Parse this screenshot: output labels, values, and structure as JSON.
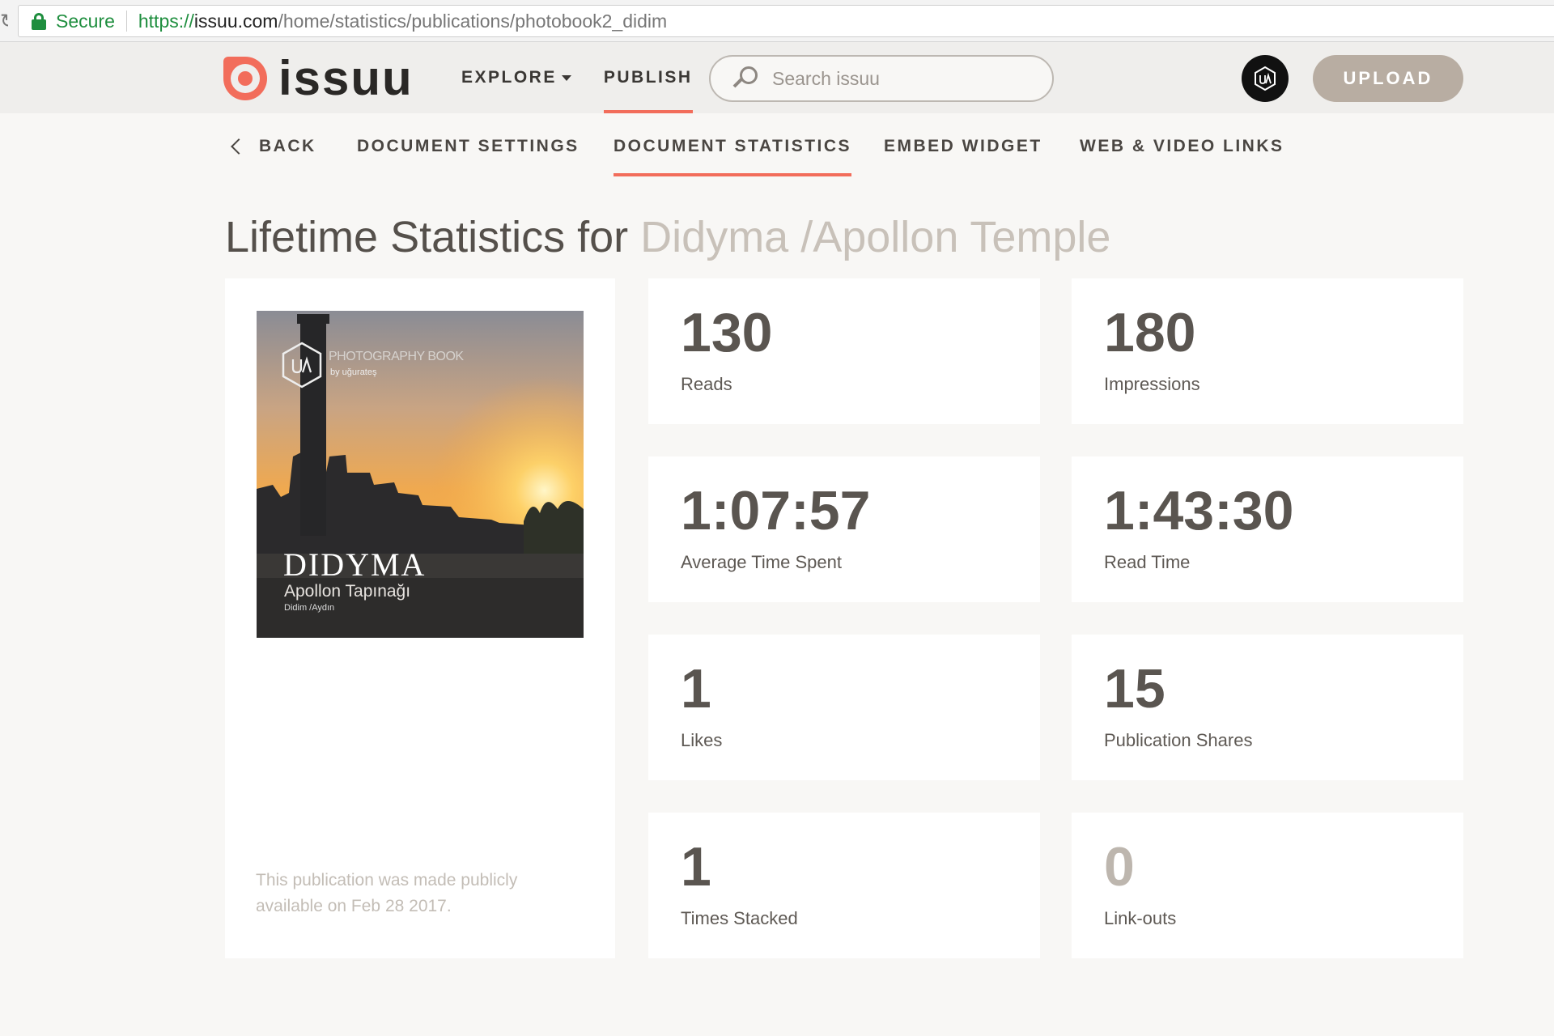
{
  "browser": {
    "secure_label": "Secure",
    "url_scheme": "https://",
    "url_host": "issuu.com",
    "url_path": "/home/statistics/publications/photobook2_didim"
  },
  "header": {
    "logo_text": "issuu",
    "nav": [
      {
        "label": "EXPLORE",
        "has_dropdown": true
      },
      {
        "label": "PUBLISH",
        "active": true
      }
    ],
    "search_placeholder": "Search issuu",
    "upload_label": "UPLOAD"
  },
  "sub_nav": {
    "back_label": "BACK",
    "tabs": [
      {
        "label": "DOCUMENT SETTINGS"
      },
      {
        "label": "DOCUMENT STATISTICS",
        "active": true
      },
      {
        "label": "EMBED WIDGET"
      },
      {
        "label": "WEB & VIDEO LINKS"
      }
    ]
  },
  "page": {
    "title_prefix": "Lifetime Statistics for ",
    "document_name": "Didyma /Apollon Temple"
  },
  "cover": {
    "series": "PHOTOGRAPHY BOOK",
    "author": "by uğurateş",
    "title": "DIDYMA",
    "subtitle": "Apollon Tapınağı",
    "place": "Didim /Aydın",
    "publish_note": "This publication was made publicly available on Feb 28 2017."
  },
  "stats": [
    {
      "value": "130",
      "label": "Reads"
    },
    {
      "value": "180",
      "label": "Impressions"
    },
    {
      "value": "1:07:57",
      "label": "Average Time Spent"
    },
    {
      "value": "1:43:30",
      "label": "Read Time"
    },
    {
      "value": "1",
      "label": "Likes"
    },
    {
      "value": "15",
      "label": "Publication Shares"
    },
    {
      "value": "1",
      "label": "Times Stacked"
    },
    {
      "value": "0",
      "label": "Link-outs"
    }
  ],
  "colors": {
    "accent": "#f26d5b",
    "upload_button": "#b8ada2",
    "secure_green": "#1e8e3e"
  }
}
